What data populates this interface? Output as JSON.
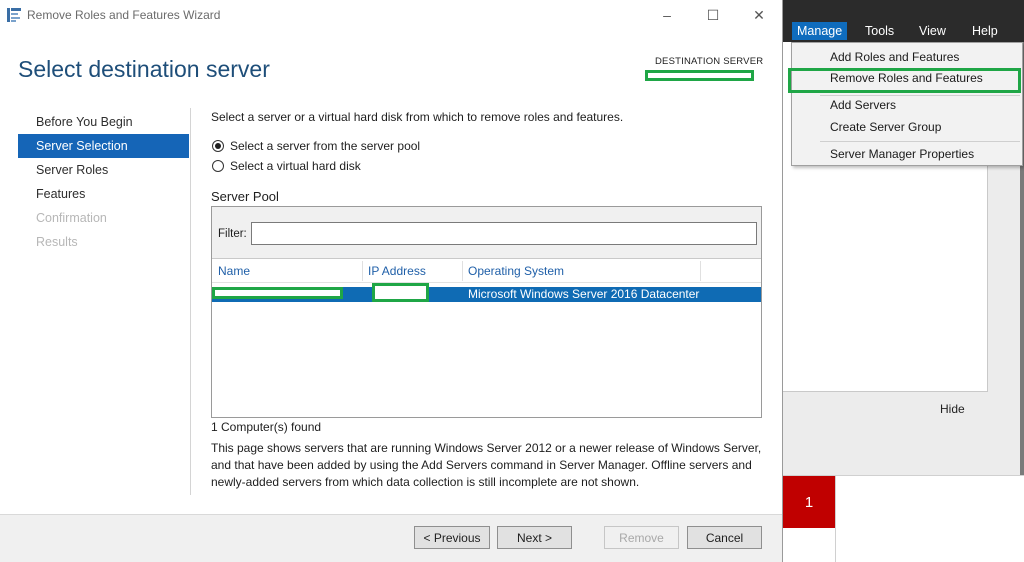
{
  "window": {
    "title": "Remove Roles and Features Wizard",
    "controls": [
      "–",
      "☐",
      "✕"
    ]
  },
  "header": {
    "page_title": "Select destination server",
    "destination_label": "DESTINATION SERVER"
  },
  "nav": {
    "items": [
      {
        "label": "Before You Begin",
        "state": "normal"
      },
      {
        "label": "Server Selection",
        "state": "selected"
      },
      {
        "label": "Server Roles",
        "state": "normal"
      },
      {
        "label": "Features",
        "state": "normal"
      },
      {
        "label": "Confirmation",
        "state": "disabled"
      },
      {
        "label": "Results",
        "state": "disabled"
      }
    ]
  },
  "content": {
    "instruction": "Select a server or a virtual hard disk from which to remove roles and features.",
    "radio_server_pool": "Select a server from the server pool",
    "radio_vhd": "Select a virtual hard disk",
    "pool_label": "Server Pool",
    "filter_label": "Filter:",
    "filter_value": "",
    "columns": [
      "Name",
      "IP Address",
      "Operating System"
    ],
    "row": {
      "os": "Microsoft Windows Server 2016 Datacenter"
    },
    "found": "1 Computer(s) found",
    "description": "This page shows servers that are running Windows Server 2012 or a newer release of Windows Server, and that have been added by using the Add Servers command in Server Manager. Offline servers and newly-added servers from which data collection is still incomplete are not shown."
  },
  "footer": {
    "previous": "< Previous",
    "next": "Next >",
    "remove": "Remove",
    "cancel": "Cancel"
  },
  "server_manager": {
    "menus": [
      "Manage",
      "Tools",
      "View",
      "Help"
    ],
    "manage_menu": {
      "add_roles": "Add Roles and Features",
      "remove_roles": "Remove Roles and Features",
      "add_servers": "Add Servers",
      "create_group": "Create Server Group",
      "properties": "Server Manager Properties"
    },
    "hide": "Hide",
    "badge_count": "1"
  },
  "colors": {
    "accent": "#1565b7",
    "title": "#1e4e79",
    "highlight": "#1fa646",
    "badge": "#c00000"
  }
}
